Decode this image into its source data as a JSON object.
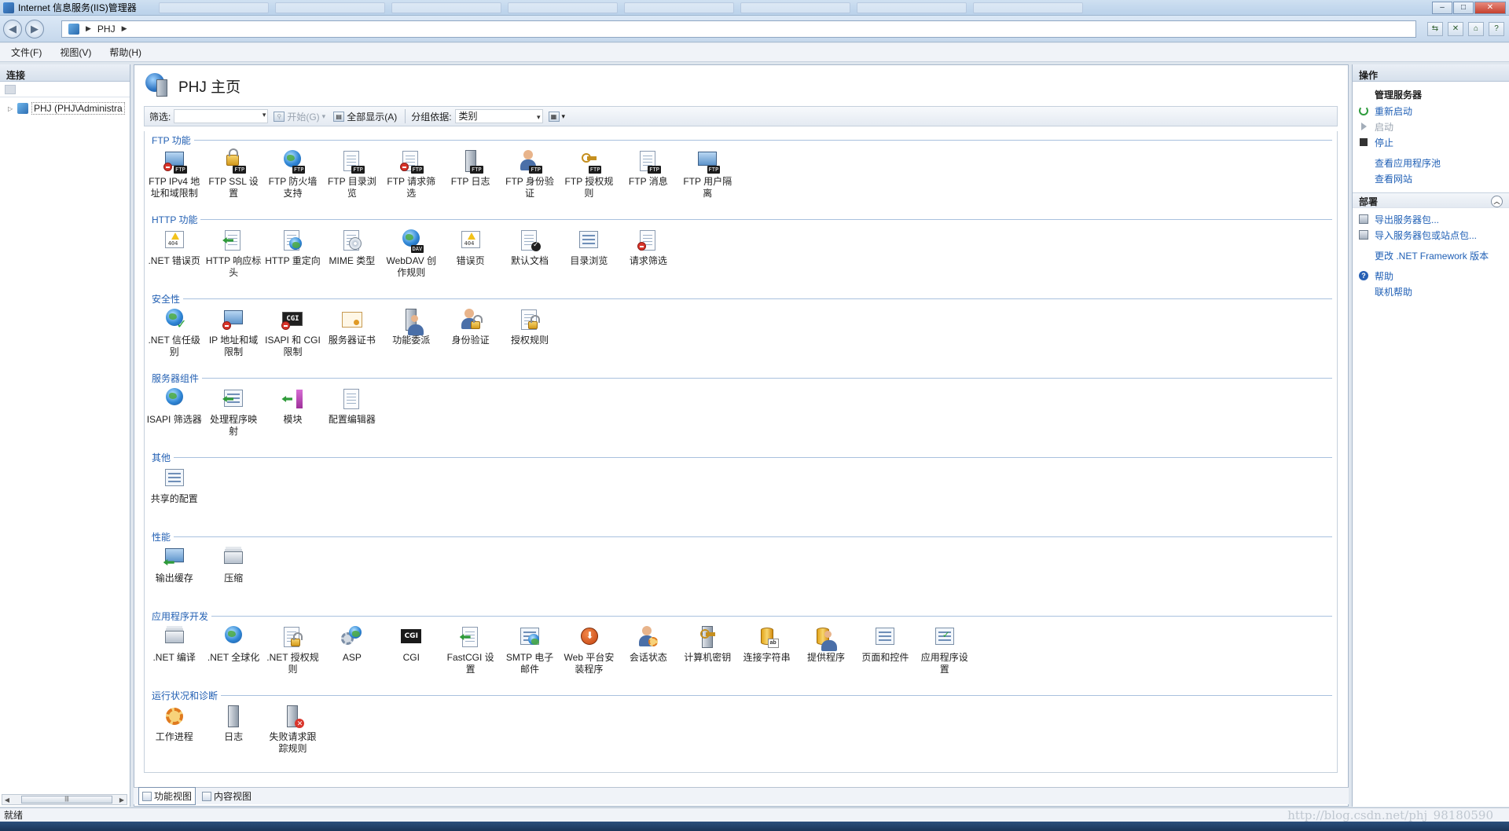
{
  "window": {
    "title": "Internet 信息服务(IIS)管理器"
  },
  "address": {
    "path": [
      "PHJ"
    ]
  },
  "menu": [
    "文件(F)",
    "视图(V)",
    "帮助(H)"
  ],
  "left_panel": {
    "title": "连接",
    "tree": [
      {
        "label": "PHJ (PHJ\\Administra"
      }
    ]
  },
  "page": {
    "title": "PHJ 主页"
  },
  "filterbar": {
    "filter_label": "筛选:",
    "start_label": "开始(G)",
    "show_all_label": "全部显示(A)",
    "group_by_label": "分组依据:",
    "group_by_value": "类别"
  },
  "sections": [
    {
      "title": "FTP 功能",
      "items": [
        {
          "label": "FTP IPv4 地址和域限制",
          "icon": "ftp-ipv4-icon"
        },
        {
          "label": "FTP SSL 设置",
          "icon": "ftp-ssl-icon"
        },
        {
          "label": "FTP 防火墙支持",
          "icon": "ftp-firewall-icon"
        },
        {
          "label": "FTP 目录浏览",
          "icon": "ftp-directory-icon"
        },
        {
          "label": "FTP 请求筛选",
          "icon": "ftp-request-filter-icon"
        },
        {
          "label": "FTP 日志",
          "icon": "ftp-log-icon"
        },
        {
          "label": "FTP 身份验证",
          "icon": "ftp-auth-icon"
        },
        {
          "label": "FTP 授权规则",
          "icon": "ftp-authz-icon"
        },
        {
          "label": "FTP 消息",
          "icon": "ftp-message-icon"
        },
        {
          "label": "FTP 用户隔离",
          "icon": "ftp-user-isolation-icon"
        }
      ]
    },
    {
      "title": "HTTP 功能",
      "items": [
        {
          "label": ".NET 错误页",
          "icon": "net-error-pages-icon"
        },
        {
          "label": "HTTP 响应标头",
          "icon": "http-response-headers-icon"
        },
        {
          "label": "HTTP 重定向",
          "icon": "http-redirect-icon"
        },
        {
          "label": "MIME 类型",
          "icon": "mime-types-icon"
        },
        {
          "label": "WebDAV 创作规则",
          "icon": "webdav-icon"
        },
        {
          "label": "错误页",
          "icon": "error-pages-icon"
        },
        {
          "label": "默认文档",
          "icon": "default-document-icon"
        },
        {
          "label": "目录浏览",
          "icon": "directory-browsing-icon"
        },
        {
          "label": "请求筛选",
          "icon": "request-filtering-icon"
        }
      ]
    },
    {
      "title": "安全性",
      "items": [
        {
          "label": ".NET 信任级别",
          "icon": "net-trust-icon"
        },
        {
          "label": "IP 地址和域限制",
          "icon": "ip-restrictions-icon"
        },
        {
          "label": "ISAPI 和 CGI 限制",
          "icon": "isapi-cgi-restrictions-icon"
        },
        {
          "label": "服务器证书",
          "icon": "server-certificates-icon"
        },
        {
          "label": "功能委派",
          "icon": "feature-delegation-icon"
        },
        {
          "label": "身份验证",
          "icon": "authentication-icon"
        },
        {
          "label": "授权规则",
          "icon": "authorization-rules-icon"
        }
      ]
    },
    {
      "title": "服务器组件",
      "items": [
        {
          "label": "ISAPI 筛选器",
          "icon": "isapi-filters-icon"
        },
        {
          "label": "处理程序映射",
          "icon": "handler-mappings-icon"
        },
        {
          "label": "模块",
          "icon": "modules-icon"
        },
        {
          "label": "配置编辑器",
          "icon": "configuration-editor-icon"
        }
      ]
    },
    {
      "title": "其他",
      "items": [
        {
          "label": "共享的配置",
          "icon": "shared-configuration-icon"
        }
      ]
    },
    {
      "title": "性能",
      "items": [
        {
          "label": "输出缓存",
          "icon": "output-caching-icon"
        },
        {
          "label": "压缩",
          "icon": "compression-icon"
        }
      ]
    },
    {
      "title": "应用程序开发",
      "items": [
        {
          "label": ".NET 编译",
          "icon": "net-compilation-icon"
        },
        {
          "label": ".NET 全球化",
          "icon": "net-globalization-icon"
        },
        {
          "label": ".NET 授权规则",
          "icon": "net-authorization-icon"
        },
        {
          "label": "ASP",
          "icon": "asp-icon"
        },
        {
          "label": "CGI",
          "icon": "cgi-icon"
        },
        {
          "label": "FastCGI 设置",
          "icon": "fastcgi-icon"
        },
        {
          "label": "SMTP 电子邮件",
          "icon": "smtp-email-icon"
        },
        {
          "label": "Web 平台安装程序",
          "icon": "web-platform-installer-icon"
        },
        {
          "label": "会话状态",
          "icon": "session-state-icon"
        },
        {
          "label": "计算机密钥",
          "icon": "machine-key-icon"
        },
        {
          "label": "连接字符串",
          "icon": "connection-strings-icon"
        },
        {
          "label": "提供程序",
          "icon": "providers-icon"
        },
        {
          "label": "页面和控件",
          "icon": "pages-controls-icon"
        },
        {
          "label": "应用程序设置",
          "icon": "application-settings-icon"
        }
      ]
    },
    {
      "title": "运行状况和诊断",
      "items": [
        {
          "label": "工作进程",
          "icon": "worker-processes-icon"
        },
        {
          "label": "日志",
          "icon": "logging-icon"
        },
        {
          "label": "失败请求跟踪规则",
          "icon": "failed-request-tracing-icon"
        }
      ]
    }
  ],
  "view_tabs": [
    "功能视图",
    "内容视图"
  ],
  "actions": {
    "title": "操作",
    "manage_server": "管理服务器",
    "restart": "重新启动",
    "start": "启动",
    "stop": "停止",
    "view_app_pools": "查看应用程序池",
    "view_sites": "查看网站",
    "deploy": "部署",
    "export_package": "导出服务器包...",
    "import_package": "导入服务器包或站点包...",
    "change_framework": "更改 .NET Framework 版本",
    "help": "帮助",
    "online_help": "联机帮助"
  },
  "status": {
    "text": "就绪",
    "watermark": "http://blog.csdn.net/phj_98180590"
  }
}
